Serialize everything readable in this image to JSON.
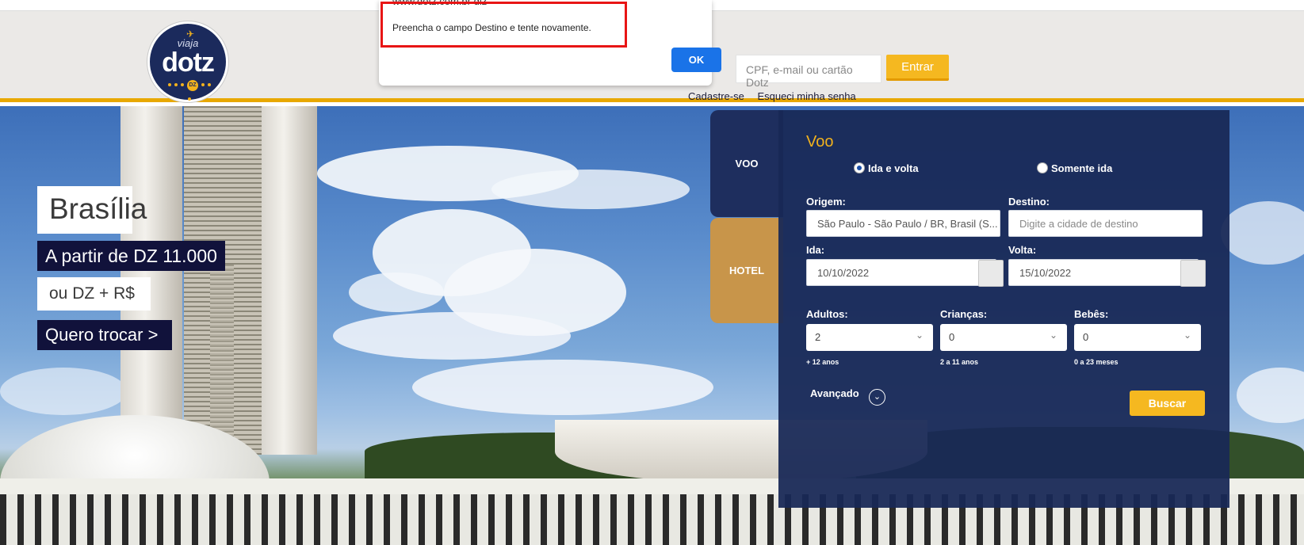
{
  "dialog": {
    "origin": "www.dotz.com.br diz",
    "message": "Preencha o campo Destino e tente novamente.",
    "ok_label": "OK"
  },
  "header": {
    "logo_top": "viaja",
    "logo_brand": "dotz",
    "logo_badge": "DZ",
    "login_placeholder": "CPF, e-mail ou cartão Dotz",
    "login_button": "Entrar",
    "signup_link": "Cadastre-se",
    "forgot_link": "Esqueci minha senha"
  },
  "promo": {
    "city": "Brasília",
    "price": "A partir de DZ 11.000",
    "alt_price": "ou DZ + R$",
    "cta": "Quero trocar >"
  },
  "search": {
    "tabs": {
      "flight": "VOO",
      "hotel": "HOTEL"
    },
    "title": "Voo",
    "trip_round": "Ida e volta",
    "trip_oneway": "Somente ida",
    "selected_trip": "Ida e volta",
    "origin_label": "Origem:",
    "origin_value": "São Paulo - São Paulo / BR, Brasil (S...",
    "destination_label": "Destino:",
    "destination_placeholder": "Digite a cidade de destino",
    "depart_label": "Ida:",
    "depart_value": "10/10/2022",
    "return_label": "Volta:",
    "return_value": "15/10/2022",
    "adults_label": "Adultos:",
    "adults_value": "2",
    "adults_hint": "+ 12 anos",
    "children_label": "Crianças:",
    "children_value": "0",
    "children_hint": "2 a 11 anos",
    "infants_label": "Bebês:",
    "infants_value": "0",
    "infants_hint": "0 a 23 meses",
    "advanced_label": "Avançado",
    "search_button": "Buscar"
  },
  "colors": {
    "accent": "#f5b820",
    "panel": "#182856",
    "promo_dark": "#11123b",
    "alert_highlight": "#e81515"
  }
}
